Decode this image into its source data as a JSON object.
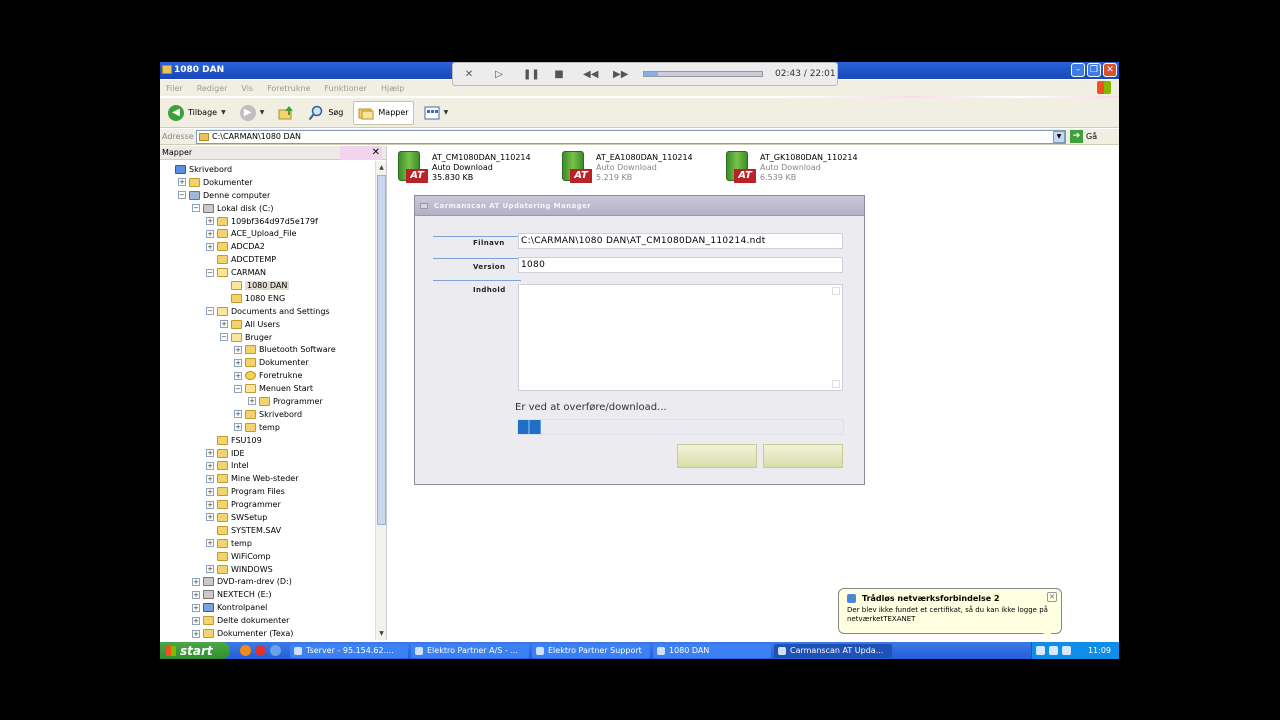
{
  "window": {
    "title": "1080 DAN"
  },
  "media": {
    "time": "02:43 / 22:01",
    "progress": 0.12
  },
  "menu": [
    "Filer",
    "Rediger",
    "Vis",
    "Foretrukne",
    "Funktioner",
    "Hjælp"
  ],
  "toolbar": {
    "back": "Tilbage",
    "search": "Søg",
    "folders": "Mapper"
  },
  "address": {
    "label": "Adresse",
    "value": "C:\\CARMAN\\1080 DAN",
    "go": "Gå"
  },
  "folders_pane": {
    "title": "Mapper"
  },
  "tree": [
    {
      "label": "Skrivebord",
      "indent": 0,
      "toggle": "",
      "icon": "desk"
    },
    {
      "label": "Dokumenter",
      "indent": 1,
      "toggle": "+",
      "icon": "folder"
    },
    {
      "label": "Denne computer",
      "indent": 1,
      "toggle": "-",
      "icon": "pc"
    },
    {
      "label": "Lokal disk (C:)",
      "indent": 2,
      "toggle": "-",
      "icon": "drive"
    },
    {
      "label": "109bf364d97d5e179f",
      "indent": 3,
      "toggle": "+",
      "icon": "folder"
    },
    {
      "label": "ACE_Upload_File",
      "indent": 3,
      "toggle": "+",
      "icon": "folder"
    },
    {
      "label": "ADCDA2",
      "indent": 3,
      "toggle": "+",
      "icon": "folder"
    },
    {
      "label": "ADCDTEMP",
      "indent": 3,
      "toggle": "",
      "icon": "folder"
    },
    {
      "label": "CARMAN",
      "indent": 3,
      "toggle": "-",
      "icon": "open"
    },
    {
      "label": "1080 DAN",
      "indent": 4,
      "toggle": "",
      "icon": "open",
      "selected": true
    },
    {
      "label": "1080 ENG",
      "indent": 4,
      "toggle": "",
      "icon": "folder"
    },
    {
      "label": "Documents and Settings",
      "indent": 3,
      "toggle": "-",
      "icon": "open"
    },
    {
      "label": "All Users",
      "indent": 4,
      "toggle": "+",
      "icon": "folder"
    },
    {
      "label": "Bruger",
      "indent": 4,
      "toggle": "-",
      "icon": "open"
    },
    {
      "label": "Bluetooth Software",
      "indent": 5,
      "toggle": "+",
      "icon": "folder"
    },
    {
      "label": "Dokumenter",
      "indent": 5,
      "toggle": "+",
      "icon": "folder"
    },
    {
      "label": "Foretrukne",
      "indent": 5,
      "toggle": "+",
      "icon": "star"
    },
    {
      "label": "Menuen Start",
      "indent": 5,
      "toggle": "-",
      "icon": "open"
    },
    {
      "label": "Programmer",
      "indent": 6,
      "toggle": "+",
      "icon": "folder"
    },
    {
      "label": "Skrivebord",
      "indent": 5,
      "toggle": "+",
      "icon": "folder"
    },
    {
      "label": "temp",
      "indent": 5,
      "toggle": "+",
      "icon": "folder"
    },
    {
      "label": "FSU109",
      "indent": 3,
      "toggle": "",
      "icon": "folder"
    },
    {
      "label": "IDE",
      "indent": 3,
      "toggle": "+",
      "icon": "folder"
    },
    {
      "label": "Intel",
      "indent": 3,
      "toggle": "+",
      "icon": "folder"
    },
    {
      "label": "Mine Web-steder",
      "indent": 3,
      "toggle": "+",
      "icon": "folder"
    },
    {
      "label": "Program Files",
      "indent": 3,
      "toggle": "+",
      "icon": "folder"
    },
    {
      "label": "Programmer",
      "indent": 3,
      "toggle": "+",
      "icon": "folder"
    },
    {
      "label": "SWSetup",
      "indent": 3,
      "toggle": "+",
      "icon": "folder"
    },
    {
      "label": "SYSTEM.SAV",
      "indent": 3,
      "toggle": "",
      "icon": "folder"
    },
    {
      "label": "temp",
      "indent": 3,
      "toggle": "+",
      "icon": "folder"
    },
    {
      "label": "WiFiComp",
      "indent": 3,
      "toggle": "",
      "icon": "folder"
    },
    {
      "label": "WINDOWS",
      "indent": 3,
      "toggle": "+",
      "icon": "folder"
    },
    {
      "label": "DVD-ram-drev (D:)",
      "indent": 2,
      "toggle": "+",
      "icon": "drive"
    },
    {
      "label": "NEXTECH (E:)",
      "indent": 2,
      "toggle": "+",
      "icon": "drive"
    },
    {
      "label": "Kontrolpanel",
      "indent": 2,
      "toggle": "+",
      "icon": "cp"
    },
    {
      "label": "Delte dokumenter",
      "indent": 2,
      "toggle": "+",
      "icon": "folder"
    },
    {
      "label": "Dokumenter (Texa)",
      "indent": 2,
      "toggle": "+",
      "icon": "folder"
    }
  ],
  "files": [
    {
      "name": "AT_CM1080DAN_110214",
      "type": "Auto Download",
      "size": "35.830 KB",
      "badge": "AT"
    },
    {
      "name": "AT_EA1080DAN_110214",
      "type": "Auto Download",
      "size": "5.219 KB",
      "badge": "AT"
    },
    {
      "name": "AT_GK1080DAN_110214",
      "type": "Auto Download",
      "size": "6.539 KB",
      "badge": "AT"
    }
  ],
  "dialog": {
    "title": "Carmanscan AT Updatering Manager",
    "filename_label": "Filnavn",
    "filename_value": "C:\\CARMAN\\1080 DAN\\AT_CM1080DAN_110214.ndt",
    "version_label": "Version",
    "version_value": "1080",
    "content_label": "Indhold",
    "status": "Er ved at overføre/download...",
    "progress": 0.07
  },
  "balloon": {
    "title": "Trådløs netværksforbindelse 2",
    "text": "Der blev ikke fundet et certifikat, så du kan ikke logge på netværketTEXANET"
  },
  "taskbar": {
    "start": "start",
    "tasks": [
      "Tserver - 95.154.62....",
      "Elektro Partner A/S - ...",
      "Elektro Partner Support",
      "1080 DAN",
      "Carmanscan AT Upda..."
    ],
    "clock": "11:09"
  }
}
